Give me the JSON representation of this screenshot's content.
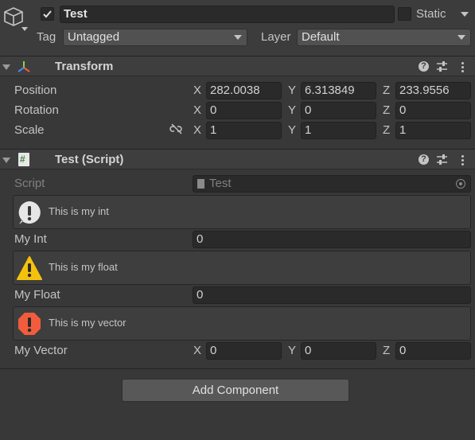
{
  "header": {
    "object_name": "Test",
    "active_checked": true,
    "static_label": "Static",
    "static_checked": false,
    "tag_label": "Tag",
    "tag_value": "Untagged",
    "layer_label": "Layer",
    "layer_value": "Default"
  },
  "transform": {
    "title": "Transform",
    "position_label": "Position",
    "rotation_label": "Rotation",
    "scale_label": "Scale",
    "axes": {
      "x": "X",
      "y": "Y",
      "z": "Z"
    },
    "position": {
      "x": "282.0038",
      "y": "6.313849",
      "z": "233.9556"
    },
    "rotation": {
      "x": "0",
      "y": "0",
      "z": "0"
    },
    "scale": {
      "x": "1",
      "y": "1",
      "z": "1"
    }
  },
  "script_component": {
    "title": "Test (Script)",
    "script_label": "Script",
    "script_value": "Test",
    "int_help": "This is my int",
    "int_label": "My Int",
    "int_value": "0",
    "float_help": "This is my float",
    "float_label": "My Float",
    "float_value": "0",
    "vector_help": "This is my vector",
    "vector_label": "My Vector",
    "vector": {
      "x": "0",
      "y": "0",
      "z": "0"
    }
  },
  "add_component_label": "Add Component",
  "colors": {
    "background": "#383838",
    "field": "#2a2a2a",
    "info_icon": "#e6e6e6",
    "warning_icon": "#f4c20d",
    "error_icon": "#f25c3c"
  }
}
